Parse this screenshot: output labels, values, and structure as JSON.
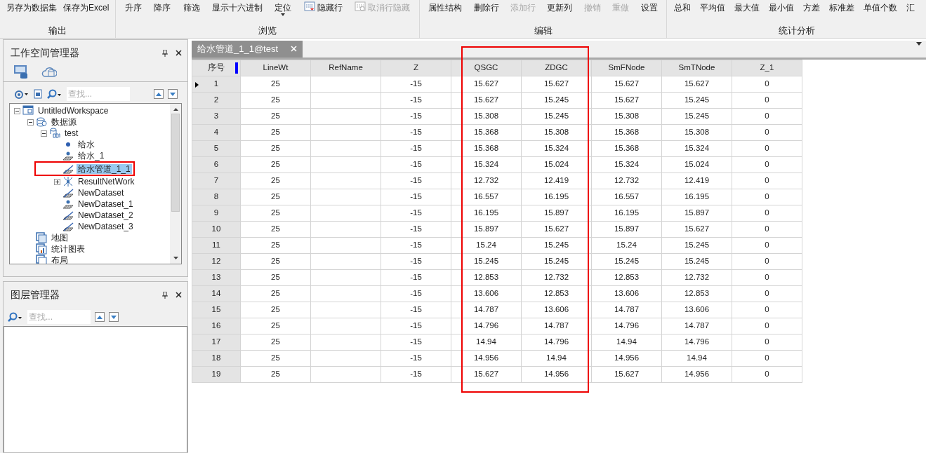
{
  "ribbon": {
    "groups": [
      {
        "label": "输出",
        "buttons": [
          {
            "label": "另存为数据集",
            "disabled": false
          },
          {
            "label": "保存为Excel",
            "disabled": false
          }
        ]
      },
      {
        "label": "浏览",
        "buttons": [
          {
            "label": "升序",
            "disabled": false
          },
          {
            "label": "降序",
            "disabled": false
          },
          {
            "label": "筛选",
            "disabled": false
          },
          {
            "label": "显示十六进制",
            "disabled": false
          },
          {
            "label": "定位",
            "disabled": false,
            "dropdown": true
          },
          {
            "label": "隐藏行",
            "disabled": false,
            "kind": "hide"
          },
          {
            "label": "取消行隐藏",
            "disabled": true,
            "kind": "unhide"
          }
        ]
      },
      {
        "label": "编辑",
        "buttons": [
          {
            "label": "属性结构",
            "disabled": false
          },
          {
            "label": "删除行",
            "disabled": false
          },
          {
            "label": "添加行",
            "disabled": true
          },
          {
            "label": "更新列",
            "disabled": false
          },
          {
            "label": "撤销",
            "disabled": true
          },
          {
            "label": "重做",
            "disabled": true
          },
          {
            "label": "设置",
            "disabled": false
          }
        ]
      },
      {
        "label": "统计分析",
        "buttons": [
          {
            "label": "总和",
            "disabled": false
          },
          {
            "label": "平均值",
            "disabled": false
          },
          {
            "label": "最大值",
            "disabled": false
          },
          {
            "label": "最小值",
            "disabled": false
          },
          {
            "label": "方差",
            "disabled": false
          },
          {
            "label": "标准差",
            "disabled": false
          },
          {
            "label": "单值个数",
            "disabled": false
          },
          {
            "label": "汇",
            "disabled": false
          }
        ]
      }
    ]
  },
  "workspace_panel": {
    "title": "工作空间管理器",
    "tabs": [
      {
        "kind": "workspace",
        "selected": true
      },
      {
        "kind": "cloud",
        "selected": false
      }
    ],
    "search": {
      "placeholder": "查找..."
    },
    "tree": [
      {
        "label": "UntitledWorkspace",
        "kind": "workspace",
        "expanded": true,
        "selected": false,
        "children": [
          {
            "label": "数据源",
            "kind": "datasources",
            "expanded": true,
            "selected": false,
            "children": [
              {
                "label": "test",
                "kind": "database",
                "expanded": true,
                "selected": false,
                "children": [
                  {
                    "label": "给水",
                    "kind": "point",
                    "selected": false
                  },
                  {
                    "label": "给水_1",
                    "kind": "point3d",
                    "selected": false
                  },
                  {
                    "label": "给水管道_1_1",
                    "kind": "line3d",
                    "selected": true,
                    "highlighted": true
                  },
                  {
                    "label": "ResultNetWork",
                    "kind": "network",
                    "expanded": false,
                    "selected": false
                  },
                  {
                    "label": "NewDataset",
                    "kind": "line3d",
                    "selected": false
                  },
                  {
                    "label": "NewDataset_1",
                    "kind": "point3d",
                    "selected": false
                  },
                  {
                    "label": "NewDataset_2",
                    "kind": "line3d",
                    "selected": false
                  },
                  {
                    "label": "NewDataset_3",
                    "kind": "line3d",
                    "selected": false
                  }
                ]
              }
            ]
          },
          {
            "label": "地图",
            "kind": "map",
            "selected": false
          },
          {
            "label": "统计图表",
            "kind": "chart",
            "selected": false
          },
          {
            "label": "布局",
            "kind": "layout",
            "selected": false
          }
        ]
      }
    ]
  },
  "layer_panel": {
    "title": "图层管理器",
    "search": {
      "placeholder": "查找..."
    }
  },
  "document_tab": {
    "label": "给水管道_1_1@test"
  },
  "table": {
    "columns": [
      {
        "label": "序号"
      },
      {
        "label": "LineWt"
      },
      {
        "label": "RefName"
      },
      {
        "label": "Z"
      },
      {
        "label": "QSGC",
        "highlighted": true
      },
      {
        "label": "ZDGC",
        "highlighted": true
      },
      {
        "label": "SmFNode"
      },
      {
        "label": "SmTNode"
      },
      {
        "label": "Z_1"
      }
    ],
    "rows": [
      {
        "current": true,
        "cells": [
          "1",
          "25",
          "",
          "-15",
          "15.627",
          "15.627",
          "15.627",
          "15.627",
          "0"
        ]
      },
      {
        "current": false,
        "cells": [
          "2",
          "25",
          "",
          "-15",
          "15.627",
          "15.245",
          "15.627",
          "15.245",
          "0"
        ]
      },
      {
        "current": false,
        "cells": [
          "3",
          "25",
          "",
          "-15",
          "15.308",
          "15.245",
          "15.308",
          "15.245",
          "0"
        ]
      },
      {
        "current": false,
        "cells": [
          "4",
          "25",
          "",
          "-15",
          "15.368",
          "15.308",
          "15.368",
          "15.308",
          "0"
        ]
      },
      {
        "current": false,
        "cells": [
          "5",
          "25",
          "",
          "-15",
          "15.368",
          "15.324",
          "15.368",
          "15.324",
          "0"
        ]
      },
      {
        "current": false,
        "cells": [
          "6",
          "25",
          "",
          "-15",
          "15.324",
          "15.024",
          "15.324",
          "15.024",
          "0"
        ]
      },
      {
        "current": false,
        "cells": [
          "7",
          "25",
          "",
          "-15",
          "12.732",
          "12.419",
          "12.732",
          "12.419",
          "0"
        ]
      },
      {
        "current": false,
        "cells": [
          "8",
          "25",
          "",
          "-15",
          "16.557",
          "16.195",
          "16.557",
          "16.195",
          "0"
        ]
      },
      {
        "current": false,
        "cells": [
          "9",
          "25",
          "",
          "-15",
          "16.195",
          "15.897",
          "16.195",
          "15.897",
          "0"
        ]
      },
      {
        "current": false,
        "cells": [
          "10",
          "25",
          "",
          "-15",
          "15.897",
          "15.627",
          "15.897",
          "15.627",
          "0"
        ]
      },
      {
        "current": false,
        "cells": [
          "11",
          "25",
          "",
          "-15",
          "15.24",
          "15.245",
          "15.24",
          "15.245",
          "0"
        ]
      },
      {
        "current": false,
        "cells": [
          "12",
          "25",
          "",
          "-15",
          "15.245",
          "15.245",
          "15.245",
          "15.245",
          "0"
        ]
      },
      {
        "current": false,
        "cells": [
          "13",
          "25",
          "",
          "-15",
          "12.853",
          "12.732",
          "12.853",
          "12.732",
          "0"
        ]
      },
      {
        "current": false,
        "cells": [
          "14",
          "25",
          "",
          "-15",
          "13.606",
          "12.853",
          "13.606",
          "12.853",
          "0"
        ]
      },
      {
        "current": false,
        "cells": [
          "15",
          "25",
          "",
          "-15",
          "14.787",
          "13.606",
          "14.787",
          "13.606",
          "0"
        ]
      },
      {
        "current": false,
        "cells": [
          "16",
          "25",
          "",
          "-15",
          "14.796",
          "14.787",
          "14.796",
          "14.787",
          "0"
        ]
      },
      {
        "current": false,
        "cells": [
          "17",
          "25",
          "",
          "-15",
          "14.94",
          "14.796",
          "14.94",
          "14.796",
          "0"
        ]
      },
      {
        "current": false,
        "cells": [
          "18",
          "25",
          "",
          "-15",
          "14.956",
          "14.94",
          "14.956",
          "14.94",
          "0"
        ]
      },
      {
        "current": false,
        "cells": [
          "19",
          "25",
          "",
          "-15",
          "15.627",
          "14.956",
          "15.627",
          "14.956",
          "0"
        ]
      }
    ]
  }
}
